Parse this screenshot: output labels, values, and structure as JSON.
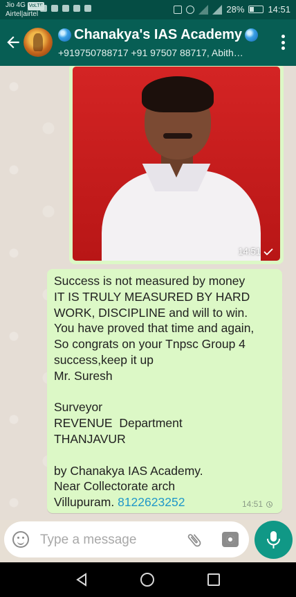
{
  "status_bar": {
    "carrier_top": "Jio 4G",
    "volte_badge": "VoLTE",
    "carrier_bottom": "Airtel|airtel",
    "battery": "28%",
    "time": "14:51"
  },
  "header": {
    "title": "Chanakya's IAS Academy",
    "subtitle": "+919750788717 +91 97507 88717, Abith…"
  },
  "messages": [
    {
      "type": "image",
      "time": "14:51",
      "status": "sent"
    },
    {
      "type": "text",
      "body": "Success is not measured by money\nIT IS TRULY MEASURED BY HARD WORK, DISCIPLINE and will to win.\nYou have proved that time and again,\nSo congrats on your Tnpsc Group 4 success,keep it up\nMr. Suresh\n\nSurveyor\nREVENUE  Department\nTHANJAVUR\n\nby Chanakya IAS Academy.\nNear Collectorate arch\nVillupuram. ",
      "phone": "8122623252",
      "time": "14:51",
      "status": "pending"
    }
  ],
  "composer": {
    "placeholder": "Type a message"
  },
  "colors": {
    "header": "#075e54",
    "status_bar": "#054d44",
    "bubble_out": "#dcf8c6",
    "accent": "#109886",
    "link": "#1f97c9"
  }
}
